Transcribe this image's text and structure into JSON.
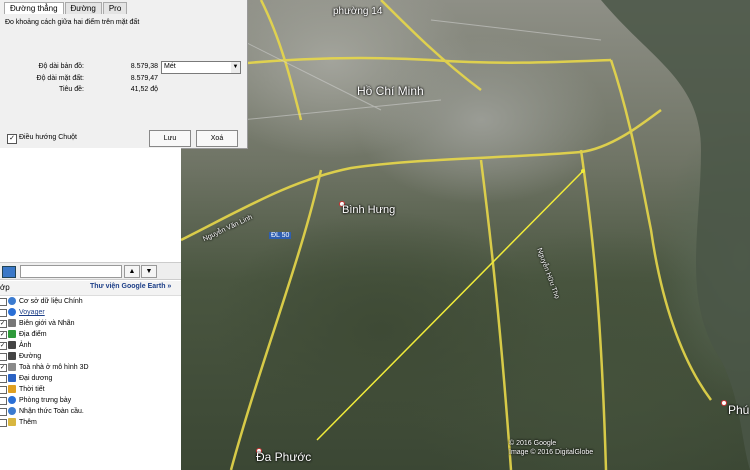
{
  "ruler": {
    "tabs": [
      "Đường thẳng",
      "Đường",
      "Pro"
    ],
    "description": "Đo khoảng cách giữa hai điểm trên mặt đất",
    "map_length_label": "Độ dài bản đồ:",
    "map_length_value": "8.579,38",
    "unit": "Mét",
    "ground_length_label": "Độ dài mặt đất:",
    "ground_length_value": "8.579,47",
    "heading_label": "Tiêu đề:",
    "heading_value": "41,52 độ",
    "mouse_nav_label": "Điều hướng Chuột",
    "save_label": "Lưu",
    "delete_label": "Xoá"
  },
  "panel": {
    "layers_tab": "ớp",
    "gallery_label": "Thư viện Google Earth »",
    "layers": [
      {
        "label": "Cơ sở dữ liệu Chính",
        "icon": "globe-icon",
        "color": "#3b7bd0",
        "checked": ""
      },
      {
        "label": "Voyager",
        "icon": "voyager-icon",
        "color": "#2a6fd6",
        "checked": ""
      },
      {
        "label": "Biên giới và Nhãn",
        "icon": "borders-icon",
        "color": "#777777",
        "checked": "✓"
      },
      {
        "label": "Địa điểm",
        "icon": "places-icon",
        "color": "#2f9a3a",
        "checked": "✓"
      },
      {
        "label": "Ảnh",
        "icon": "photo-icon",
        "color": "#444444",
        "checked": "✓"
      },
      {
        "label": "Đường",
        "icon": "roads-icon",
        "color": "#444444",
        "checked": ""
      },
      {
        "label": "Toà nhà ở mô hình 3D",
        "icon": "building-icon",
        "color": "#8a8a8a",
        "checked": "✓"
      },
      {
        "label": "Đại dương",
        "icon": "ocean-icon",
        "color": "#2a62c4",
        "checked": ""
      },
      {
        "label": "Thời tiết",
        "icon": "weather-icon",
        "color": "#e0a020",
        "checked": ""
      },
      {
        "label": "Phòng trưng bày",
        "icon": "gallery-icon",
        "color": "#2a6fd6",
        "checked": ""
      },
      {
        "label": "Nhận thức Toàn cầu.",
        "icon": "awareness-icon",
        "color": "#3b7bd0",
        "checked": ""
      },
      {
        "label": "Thêm",
        "icon": "more-icon",
        "color": "#d8b640",
        "checked": ""
      }
    ]
  },
  "map": {
    "labels": {
      "ward": "phường 14",
      "city": "Hồ Chí Minh",
      "binh_hung": "Bình Hưng",
      "da_phuoc": "Đa Phước",
      "phu": "Phú",
      "route": "ĐL 50",
      "road1": "Nguyễn Văn Linh",
      "road2": "Nguyễn Hữu Thọ",
      "copyright1": "© 2016 Google",
      "copyright2": "Image © 2016 DigitalGlobe"
    },
    "colors": {
      "road": "#e8d84a",
      "measure_line": "#f1ec3a"
    }
  }
}
